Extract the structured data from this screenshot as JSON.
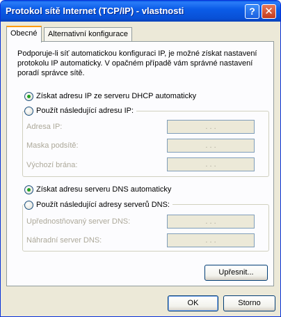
{
  "window": {
    "title": "Protokol sítě Internet (TCP/IP) - vlastnosti",
    "help_label": "?",
    "close_label": "✕"
  },
  "tabs": [
    {
      "label": "Obecné",
      "active": true
    },
    {
      "label": "Alternativní konfigurace",
      "active": false
    }
  ],
  "description": "Podporuje-li síť automatickou konfiguraci IP, je možné získat nastavení protokolu IP automaticky. V opačném případě vám správné nastavení poradí správce sítě.",
  "ip": {
    "auto_label": "Získat adresu IP ze serveru DHCP automaticky",
    "auto_checked": true,
    "manual_label": "Použít následující adresu IP:",
    "manual_checked": false,
    "fields": [
      {
        "label": "Adresa IP:",
        "value": ". . ."
      },
      {
        "label": "Maska podsítě:",
        "value": ". . ."
      },
      {
        "label": "Výchozí brána:",
        "value": ". . ."
      }
    ]
  },
  "dns": {
    "auto_label": "Získat adresu serveru DNS automaticky",
    "auto_checked": true,
    "manual_label": "Použít následující adresy serverů DNS:",
    "manual_checked": false,
    "fields": [
      {
        "label": "Upřednostňovaný server DNS:",
        "value": ". . ."
      },
      {
        "label": "Náhradní server DNS:",
        "value": ". . ."
      }
    ]
  },
  "buttons": {
    "advanced": "Upřesnit...",
    "ok": "OK",
    "cancel": "Storno"
  },
  "colors": {
    "titlebar": "#0a5be6",
    "face": "#ece9d8",
    "active_tab_accent": "#ff9a00",
    "radio_dot": "#21a121"
  }
}
